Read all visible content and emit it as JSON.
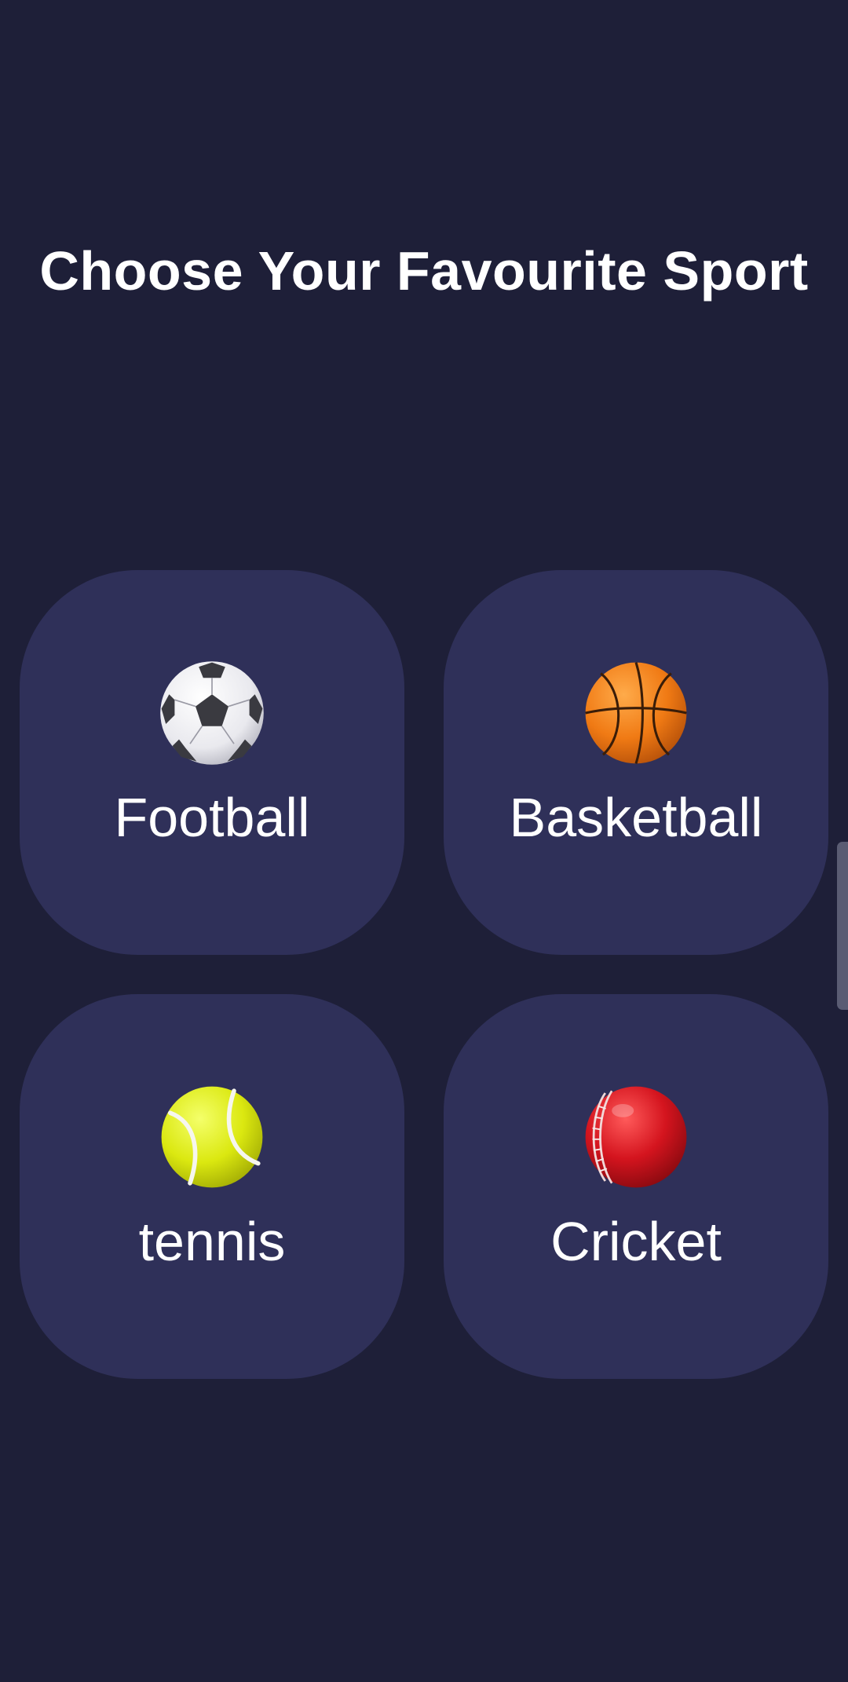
{
  "header": {
    "title": "Choose Your Favourite Sport"
  },
  "sports": [
    {
      "label": "Football",
      "icon": "soccer-ball-icon"
    },
    {
      "label": "Basketball",
      "icon": "basketball-icon"
    },
    {
      "label": "tennis",
      "icon": "tennis-ball-icon"
    },
    {
      "label": "Cricket",
      "icon": "cricket-ball-icon"
    }
  ],
  "colors": {
    "background": "#1e1f38",
    "card": "#2f3059",
    "text": "#ffffff"
  }
}
